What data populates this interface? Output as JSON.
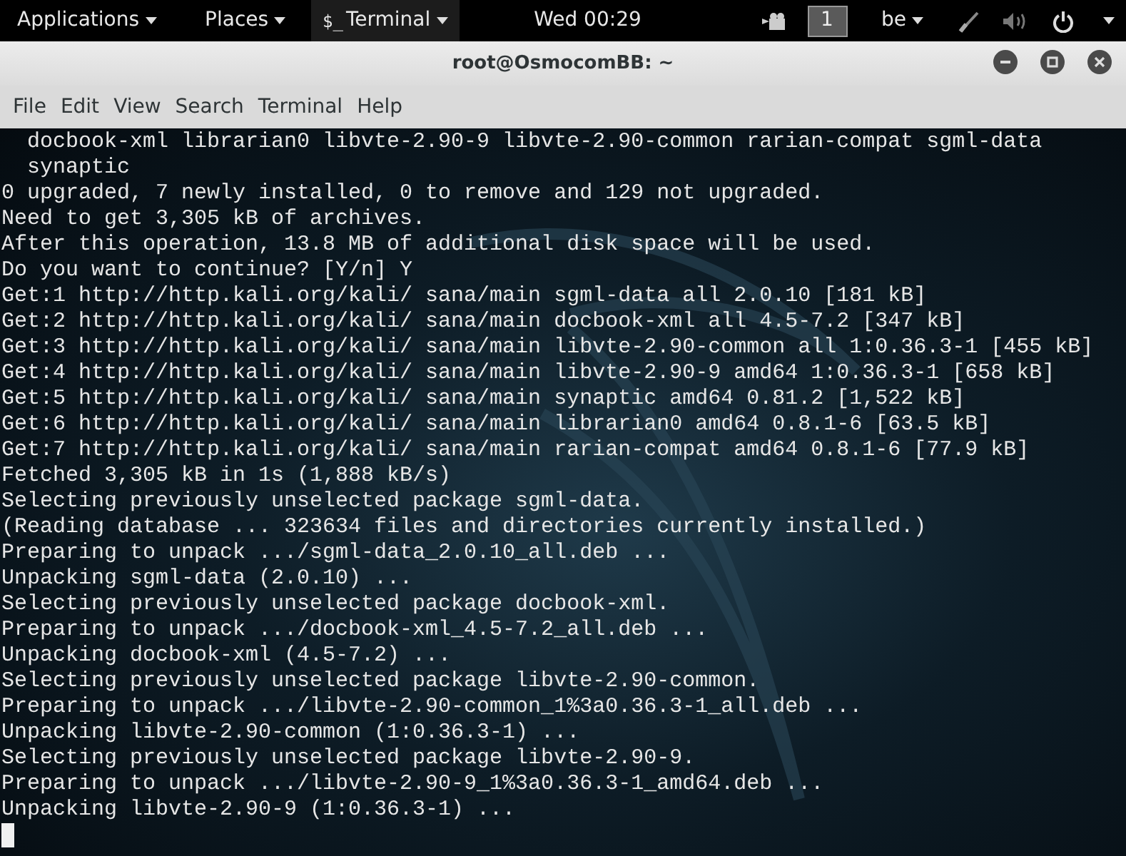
{
  "top_bar": {
    "applications": "Applications",
    "places": "Places",
    "app_menu": "Terminal",
    "app_icon": "$_",
    "clock": "Wed 00:29",
    "workspace": "1",
    "keyboard_layout": "be"
  },
  "window": {
    "title": "root@OsmocomBB: ~"
  },
  "menu": [
    "File",
    "Edit",
    "View",
    "Search",
    "Terminal",
    "Help"
  ],
  "terminal": {
    "lines": [
      "  docbook-xml librarian0 libvte-2.90-9 libvte-2.90-common rarian-compat sgml-data",
      "  synaptic",
      "0 upgraded, 7 newly installed, 0 to remove and 129 not upgraded.",
      "Need to get 3,305 kB of archives.",
      "After this operation, 13.8 MB of additional disk space will be used.",
      "Do you want to continue? [Y/n] Y",
      "Get:1 http://http.kali.org/kali/ sana/main sgml-data all 2.0.10 [181 kB]",
      "Get:2 http://http.kali.org/kali/ sana/main docbook-xml all 4.5-7.2 [347 kB]",
      "Get:3 http://http.kali.org/kali/ sana/main libvte-2.90-common all 1:0.36.3-1 [455 kB]",
      "Get:4 http://http.kali.org/kali/ sana/main libvte-2.90-9 amd64 1:0.36.3-1 [658 kB]",
      "Get:5 http://http.kali.org/kali/ sana/main synaptic amd64 0.81.2 [1,522 kB]",
      "Get:6 http://http.kali.org/kali/ sana/main librarian0 amd64 0.8.1-6 [63.5 kB]",
      "Get:7 http://http.kali.org/kali/ sana/main rarian-compat amd64 0.8.1-6 [77.9 kB]",
      "Fetched 3,305 kB in 1s (1,888 kB/s)",
      "Selecting previously unselected package sgml-data.",
      "(Reading database ... 323634 files and directories currently installed.)",
      "Preparing to unpack .../sgml-data_2.0.10_all.deb ...",
      "Unpacking sgml-data (2.0.10) ...",
      "Selecting previously unselected package docbook-xml.",
      "Preparing to unpack .../docbook-xml_4.5-7.2_all.deb ...",
      "Unpacking docbook-xml (4.5-7.2) ...",
      "Selecting previously unselected package libvte-2.90-common.",
      "Preparing to unpack .../libvte-2.90-common_1%3a0.36.3-1_all.deb ...",
      "Unpacking libvte-2.90-common (1:0.36.3-1) ...",
      "Selecting previously unselected package libvte-2.90-9.",
      "Preparing to unpack .../libvte-2.90-9_1%3a0.36.3-1_amd64.deb ...",
      "Unpacking libvte-2.90-9 (1:0.36.3-1) ..."
    ],
    "cursor": true
  }
}
